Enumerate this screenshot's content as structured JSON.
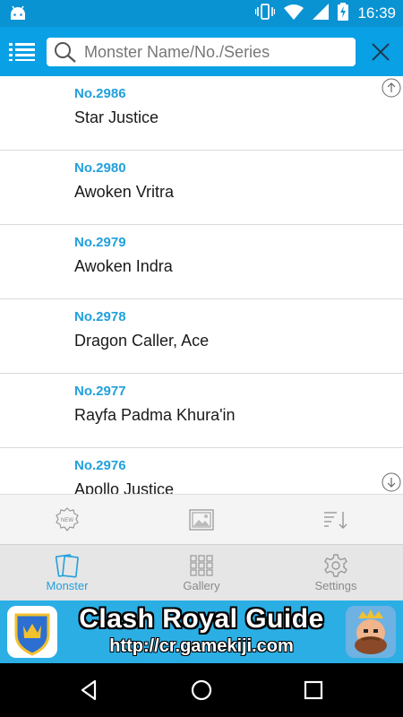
{
  "status_bar": {
    "time": "16:39",
    "icons": [
      "android-icon",
      "vibrate-icon",
      "wifi-icon",
      "signal-icon",
      "battery-charging-icon"
    ],
    "color": "#0a93d3"
  },
  "app_bar": {
    "color": "#0aa0e5",
    "menu_icon": "list-menu-icon",
    "search_placeholder": "Monster Name/No./Series",
    "search_value": "",
    "close_icon": "close-icon"
  },
  "monsters": [
    {
      "number": "No.2986",
      "name": "Star Justice"
    },
    {
      "number": "No.2980",
      "name": "Awoken Vritra"
    },
    {
      "number": "No.2979",
      "name": "Awoken Indra"
    },
    {
      "number": "No.2978",
      "name": "Dragon Caller, Ace"
    },
    {
      "number": "No.2977",
      "name": "Rayfa Padma Khura'in"
    },
    {
      "number": "No.2976",
      "name": "Apollo Justice"
    }
  ],
  "toolbar": {
    "icons": [
      "new-badge-icon",
      "image-gallery-icon",
      "sort-icon"
    ],
    "new_badge_text": "NEW"
  },
  "bottom_nav": {
    "tabs": [
      {
        "label": "Monster",
        "icon": "cards-icon",
        "active": true
      },
      {
        "label": "Gallery",
        "icon": "grid-icon",
        "active": false
      },
      {
        "label": "Settings",
        "icon": "gear-icon",
        "active": false
      }
    ],
    "active_color": "#22a0dc"
  },
  "ad": {
    "title": "Clash Royal Guide",
    "url": "http://cr.gamekiji.com",
    "background": "#2baee4"
  },
  "system_nav": {
    "icons": [
      "back-icon",
      "home-icon",
      "recents-icon"
    ]
  }
}
